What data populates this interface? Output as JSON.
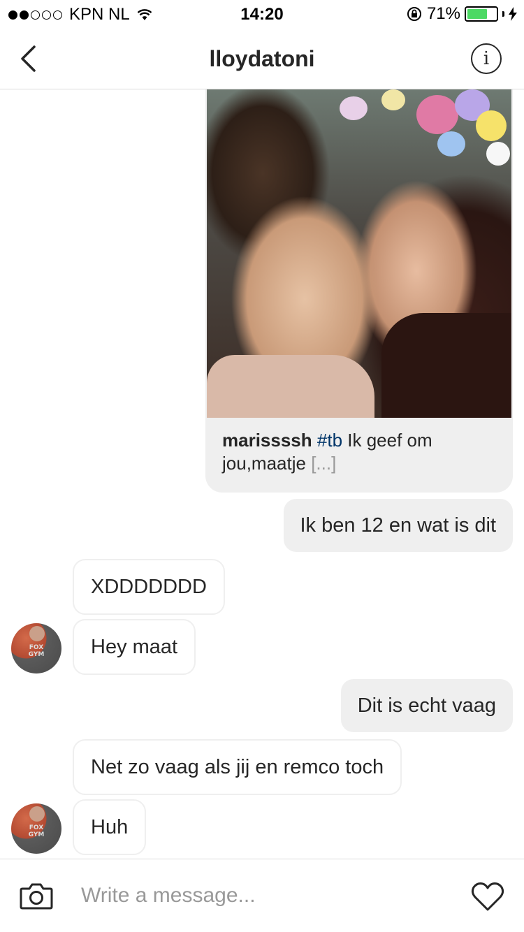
{
  "status_bar": {
    "carrier": "KPN NL",
    "time": "14:20",
    "battery_percent": "71%",
    "battery_level": 0.71,
    "signal_bars_filled": 2,
    "signal_bars_total": 5
  },
  "header": {
    "title": "lloydatoni",
    "back_icon": "chevron-left-icon",
    "info_icon": "info-icon",
    "info_glyph": "i"
  },
  "shared_post": {
    "username": "marissssh",
    "hashtag": "#tb",
    "caption_text": " Ik geef om jou,maatje ",
    "more": "[...]"
  },
  "messages": [
    {
      "direction": "outgoing",
      "text": "Ik ben 12 en wat is dit"
    },
    {
      "direction": "incoming",
      "text": "XDDDDDDD"
    },
    {
      "direction": "incoming",
      "text": "Hey maat"
    },
    {
      "direction": "outgoing",
      "text": "Dit is echt vaag"
    },
    {
      "direction": "incoming",
      "text": "Net zo vaag als jij en remco toch"
    },
    {
      "direction": "incoming",
      "text": "Huh"
    }
  ],
  "avatar_print": "FOX GYM",
  "composer": {
    "placeholder": "Write a message...",
    "camera_icon": "camera-icon",
    "like_icon": "heart-icon"
  },
  "colors": {
    "outgoing_bubble": "#efefef",
    "incoming_border": "#efefef",
    "battery_green": "#4cd964",
    "hashtag": "#003569"
  }
}
